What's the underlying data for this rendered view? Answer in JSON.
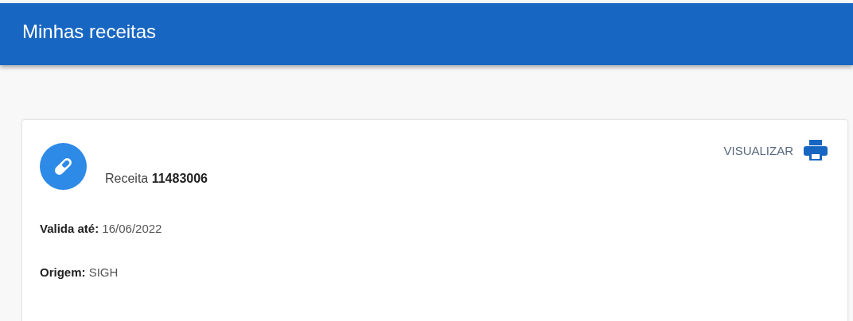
{
  "header": {
    "title": "Minhas receitas"
  },
  "prescriptions": [
    {
      "title": "Receita **11483006**",
      "action": "VISUALIZAR",
      "details": [
        "**Valida até:** 16/06/2022",
        "**Origem:** SIGH"
      ]
    }
  ]
}
